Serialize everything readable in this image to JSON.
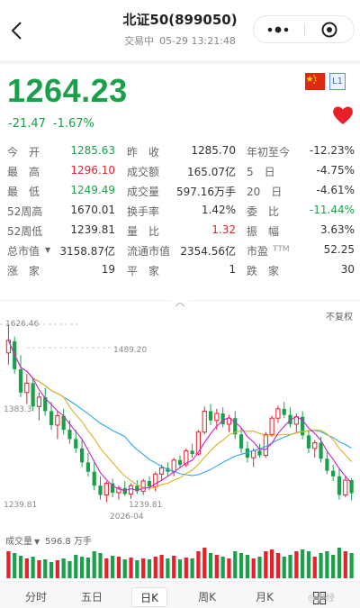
{
  "header": {
    "title": "北证50(899050)",
    "status": "交易中",
    "datetime": "05-29 13:21:48",
    "back_icon": "chevron-left-icon",
    "more_icon": "more-dots-icon",
    "close_icon": "target-close-icon"
  },
  "quote": {
    "price": "1264.23",
    "change": "-21.47",
    "change_pct": "-1.67%",
    "level_badge": "L1",
    "flag_icon": "china-flag-icon",
    "favorite_icon": "heart-icon",
    "down_color": "#1aa04a",
    "up_color": "#e8202a"
  },
  "stats": [
    [
      {
        "label": "今　开",
        "value": "1285.63",
        "tone": "down"
      },
      {
        "label": "昨　收",
        "value": "1285.70",
        "tone": ""
      },
      {
        "label": "年初至今",
        "value": "-12.23%",
        "tone": ""
      }
    ],
    [
      {
        "label": "最　高",
        "value": "1296.10",
        "tone": "up"
      },
      {
        "label": "成交额",
        "value": "165.07亿",
        "tone": ""
      },
      {
        "label": "5　日",
        "value": "-4.75%",
        "tone": ""
      }
    ],
    [
      {
        "label": "最　低",
        "value": "1249.49",
        "tone": "down"
      },
      {
        "label": "成交量",
        "value": "597.16万手",
        "tone": ""
      },
      {
        "label": "20　日",
        "value": "-4.61%",
        "tone": ""
      }
    ],
    [
      {
        "label": "52周高",
        "value": "1670.01",
        "tone": ""
      },
      {
        "label": "换手率",
        "value": "1.42%",
        "tone": ""
      },
      {
        "label": "委　比",
        "value": "-11.44%",
        "tone": "down"
      }
    ],
    [
      {
        "label": "52周低",
        "value": "1239.81",
        "tone": ""
      },
      {
        "label": "量　比",
        "value": "1.32",
        "tone": "up"
      },
      {
        "label": "振　幅",
        "value": "3.63%",
        "tone": ""
      }
    ],
    [
      {
        "label": "总市值",
        "value": "3158.87亿",
        "tone": ""
      },
      {
        "label": "流通市值",
        "value": "2354.56亿",
        "tone": ""
      },
      {
        "label": "市盈",
        "value": "52.25",
        "tone": ""
      }
    ],
    [
      {
        "label": "涨　家",
        "value": "19",
        "tone": ""
      },
      {
        "label": "平　家",
        "value": "1",
        "tone": ""
      },
      {
        "label": "跌　家",
        "value": "30",
        "tone": ""
      }
    ]
  ],
  "stats_extra": {
    "ttm_suffix": "TTM",
    "dropdown_icon": "triangle-down-icon"
  },
  "chart": {
    "adjust_label": "不复权",
    "y_high": "1626.46",
    "y_mid": "1383.3",
    "y_low": "1239.81",
    "high_marker": "1489.20",
    "low_marker": "1239.81",
    "x_date": "2026-04",
    "volume_label": "成交量",
    "volume_value": "596.8 万手",
    "collapse_icon": "chevron-up-icon"
  },
  "chart_data": {
    "type": "candlestick",
    "ylim": [
      1239.81,
      1626.46
    ],
    "candles": [
      {
        "o": 1565,
        "h": 1626,
        "l": 1540,
        "c": 1592
      },
      {
        "o": 1590,
        "h": 1600,
        "l": 1520,
        "c": 1530
      },
      {
        "o": 1530,
        "h": 1560,
        "l": 1470,
        "c": 1480
      },
      {
        "o": 1480,
        "h": 1520,
        "l": 1455,
        "c": 1500
      },
      {
        "o": 1500,
        "h": 1510,
        "l": 1440,
        "c": 1450
      },
      {
        "o": 1450,
        "h": 1480,
        "l": 1420,
        "c": 1470
      },
      {
        "o": 1470,
        "h": 1490,
        "l": 1430,
        "c": 1440
      },
      {
        "o": 1440,
        "h": 1460,
        "l": 1400,
        "c": 1410
      },
      {
        "o": 1410,
        "h": 1440,
        "l": 1380,
        "c": 1430
      },
      {
        "o": 1430,
        "h": 1445,
        "l": 1390,
        "c": 1400
      },
      {
        "o": 1400,
        "h": 1420,
        "l": 1370,
        "c": 1380
      },
      {
        "o": 1380,
        "h": 1400,
        "l": 1350,
        "c": 1360
      },
      {
        "o": 1360,
        "h": 1380,
        "l": 1320,
        "c": 1330
      },
      {
        "o": 1330,
        "h": 1350,
        "l": 1300,
        "c": 1310
      },
      {
        "o": 1310,
        "h": 1330,
        "l": 1270,
        "c": 1280
      },
      {
        "o": 1280,
        "h": 1300,
        "l": 1250,
        "c": 1260
      },
      {
        "o": 1260,
        "h": 1290,
        "l": 1245,
        "c": 1285
      },
      {
        "o": 1285,
        "h": 1295,
        "l": 1255,
        "c": 1265
      },
      {
        "o": 1265,
        "h": 1280,
        "l": 1250,
        "c": 1275
      },
      {
        "o": 1275,
        "h": 1290,
        "l": 1258,
        "c": 1262
      },
      {
        "o": 1262,
        "h": 1285,
        "l": 1252,
        "c": 1280
      },
      {
        "o": 1280,
        "h": 1292,
        "l": 1262,
        "c": 1268
      },
      {
        "o": 1268,
        "h": 1295,
        "l": 1260,
        "c": 1290
      },
      {
        "o": 1290,
        "h": 1300,
        "l": 1270,
        "c": 1278
      },
      {
        "o": 1278,
        "h": 1310,
        "l": 1268,
        "c": 1305
      },
      {
        "o": 1305,
        "h": 1325,
        "l": 1290,
        "c": 1318
      },
      {
        "o": 1318,
        "h": 1330,
        "l": 1300,
        "c": 1310
      },
      {
        "o": 1310,
        "h": 1340,
        "l": 1300,
        "c": 1335
      },
      {
        "o": 1335,
        "h": 1345,
        "l": 1318,
        "c": 1325
      },
      {
        "o": 1325,
        "h": 1360,
        "l": 1320,
        "c": 1355
      },
      {
        "o": 1355,
        "h": 1370,
        "l": 1340,
        "c": 1348
      },
      {
        "o": 1348,
        "h": 1400,
        "l": 1345,
        "c": 1395
      },
      {
        "o": 1395,
        "h": 1450,
        "l": 1390,
        "c": 1440
      },
      {
        "o": 1440,
        "h": 1455,
        "l": 1410,
        "c": 1420
      },
      {
        "o": 1420,
        "h": 1445,
        "l": 1400,
        "c": 1435
      },
      {
        "o": 1435,
        "h": 1448,
        "l": 1405,
        "c": 1412
      },
      {
        "o": 1412,
        "h": 1432,
        "l": 1395,
        "c": 1425
      },
      {
        "o": 1425,
        "h": 1440,
        "l": 1380,
        "c": 1390
      },
      {
        "o": 1390,
        "h": 1405,
        "l": 1350,
        "c": 1360
      },
      {
        "o": 1360,
        "h": 1375,
        "l": 1330,
        "c": 1340
      },
      {
        "o": 1340,
        "h": 1360,
        "l": 1320,
        "c": 1355
      },
      {
        "o": 1355,
        "h": 1370,
        "l": 1340,
        "c": 1345
      },
      {
        "o": 1345,
        "h": 1395,
        "l": 1340,
        "c": 1390
      },
      {
        "o": 1390,
        "h": 1430,
        "l": 1385,
        "c": 1425
      },
      {
        "o": 1425,
        "h": 1452,
        "l": 1415,
        "c": 1445
      },
      {
        "o": 1445,
        "h": 1460,
        "l": 1425,
        "c": 1432
      },
      {
        "o": 1432,
        "h": 1448,
        "l": 1405,
        "c": 1412
      },
      {
        "o": 1412,
        "h": 1435,
        "l": 1395,
        "c": 1428
      },
      {
        "o": 1428,
        "h": 1440,
        "l": 1380,
        "c": 1388
      },
      {
        "o": 1388,
        "h": 1400,
        "l": 1350,
        "c": 1360
      },
      {
        "o": 1360,
        "h": 1378,
        "l": 1340,
        "c": 1372
      },
      {
        "o": 1372,
        "h": 1385,
        "l": 1330,
        "c": 1338
      },
      {
        "o": 1338,
        "h": 1352,
        "l": 1305,
        "c": 1312
      },
      {
        "o": 1312,
        "h": 1325,
        "l": 1290,
        "c": 1300
      },
      {
        "o": 1300,
        "h": 1318,
        "l": 1250,
        "c": 1260
      },
      {
        "o": 1260,
        "h": 1300,
        "l": 1255,
        "c": 1292
      },
      {
        "o": 1292,
        "h": 1296,
        "l": 1249,
        "c": 1264
      }
    ],
    "volumes": [
      30,
      28,
      25,
      22,
      24,
      20,
      21,
      18,
      20,
      22,
      19,
      26,
      24,
      23,
      30,
      28,
      22,
      25,
      24,
      21,
      23,
      20,
      22,
      21,
      24,
      26,
      22,
      25,
      21,
      23,
      22,
      30,
      34,
      28,
      26,
      24,
      22,
      30,
      28,
      26,
      22,
      24,
      30,
      32,
      28,
      24,
      26,
      30,
      32,
      30,
      24,
      28,
      30,
      26,
      34,
      30,
      28
    ],
    "ma_colors": {
      "ma5": "#d020c8",
      "ma10": "#e0b020",
      "ma20": "#30a8e8"
    }
  },
  "tabs": [
    "分时",
    "五日",
    "日K",
    "周K",
    "月K"
  ],
  "tab_active": "日K",
  "grid_icon": "grid-layout-icon",
  "watermark": "@财经"
}
